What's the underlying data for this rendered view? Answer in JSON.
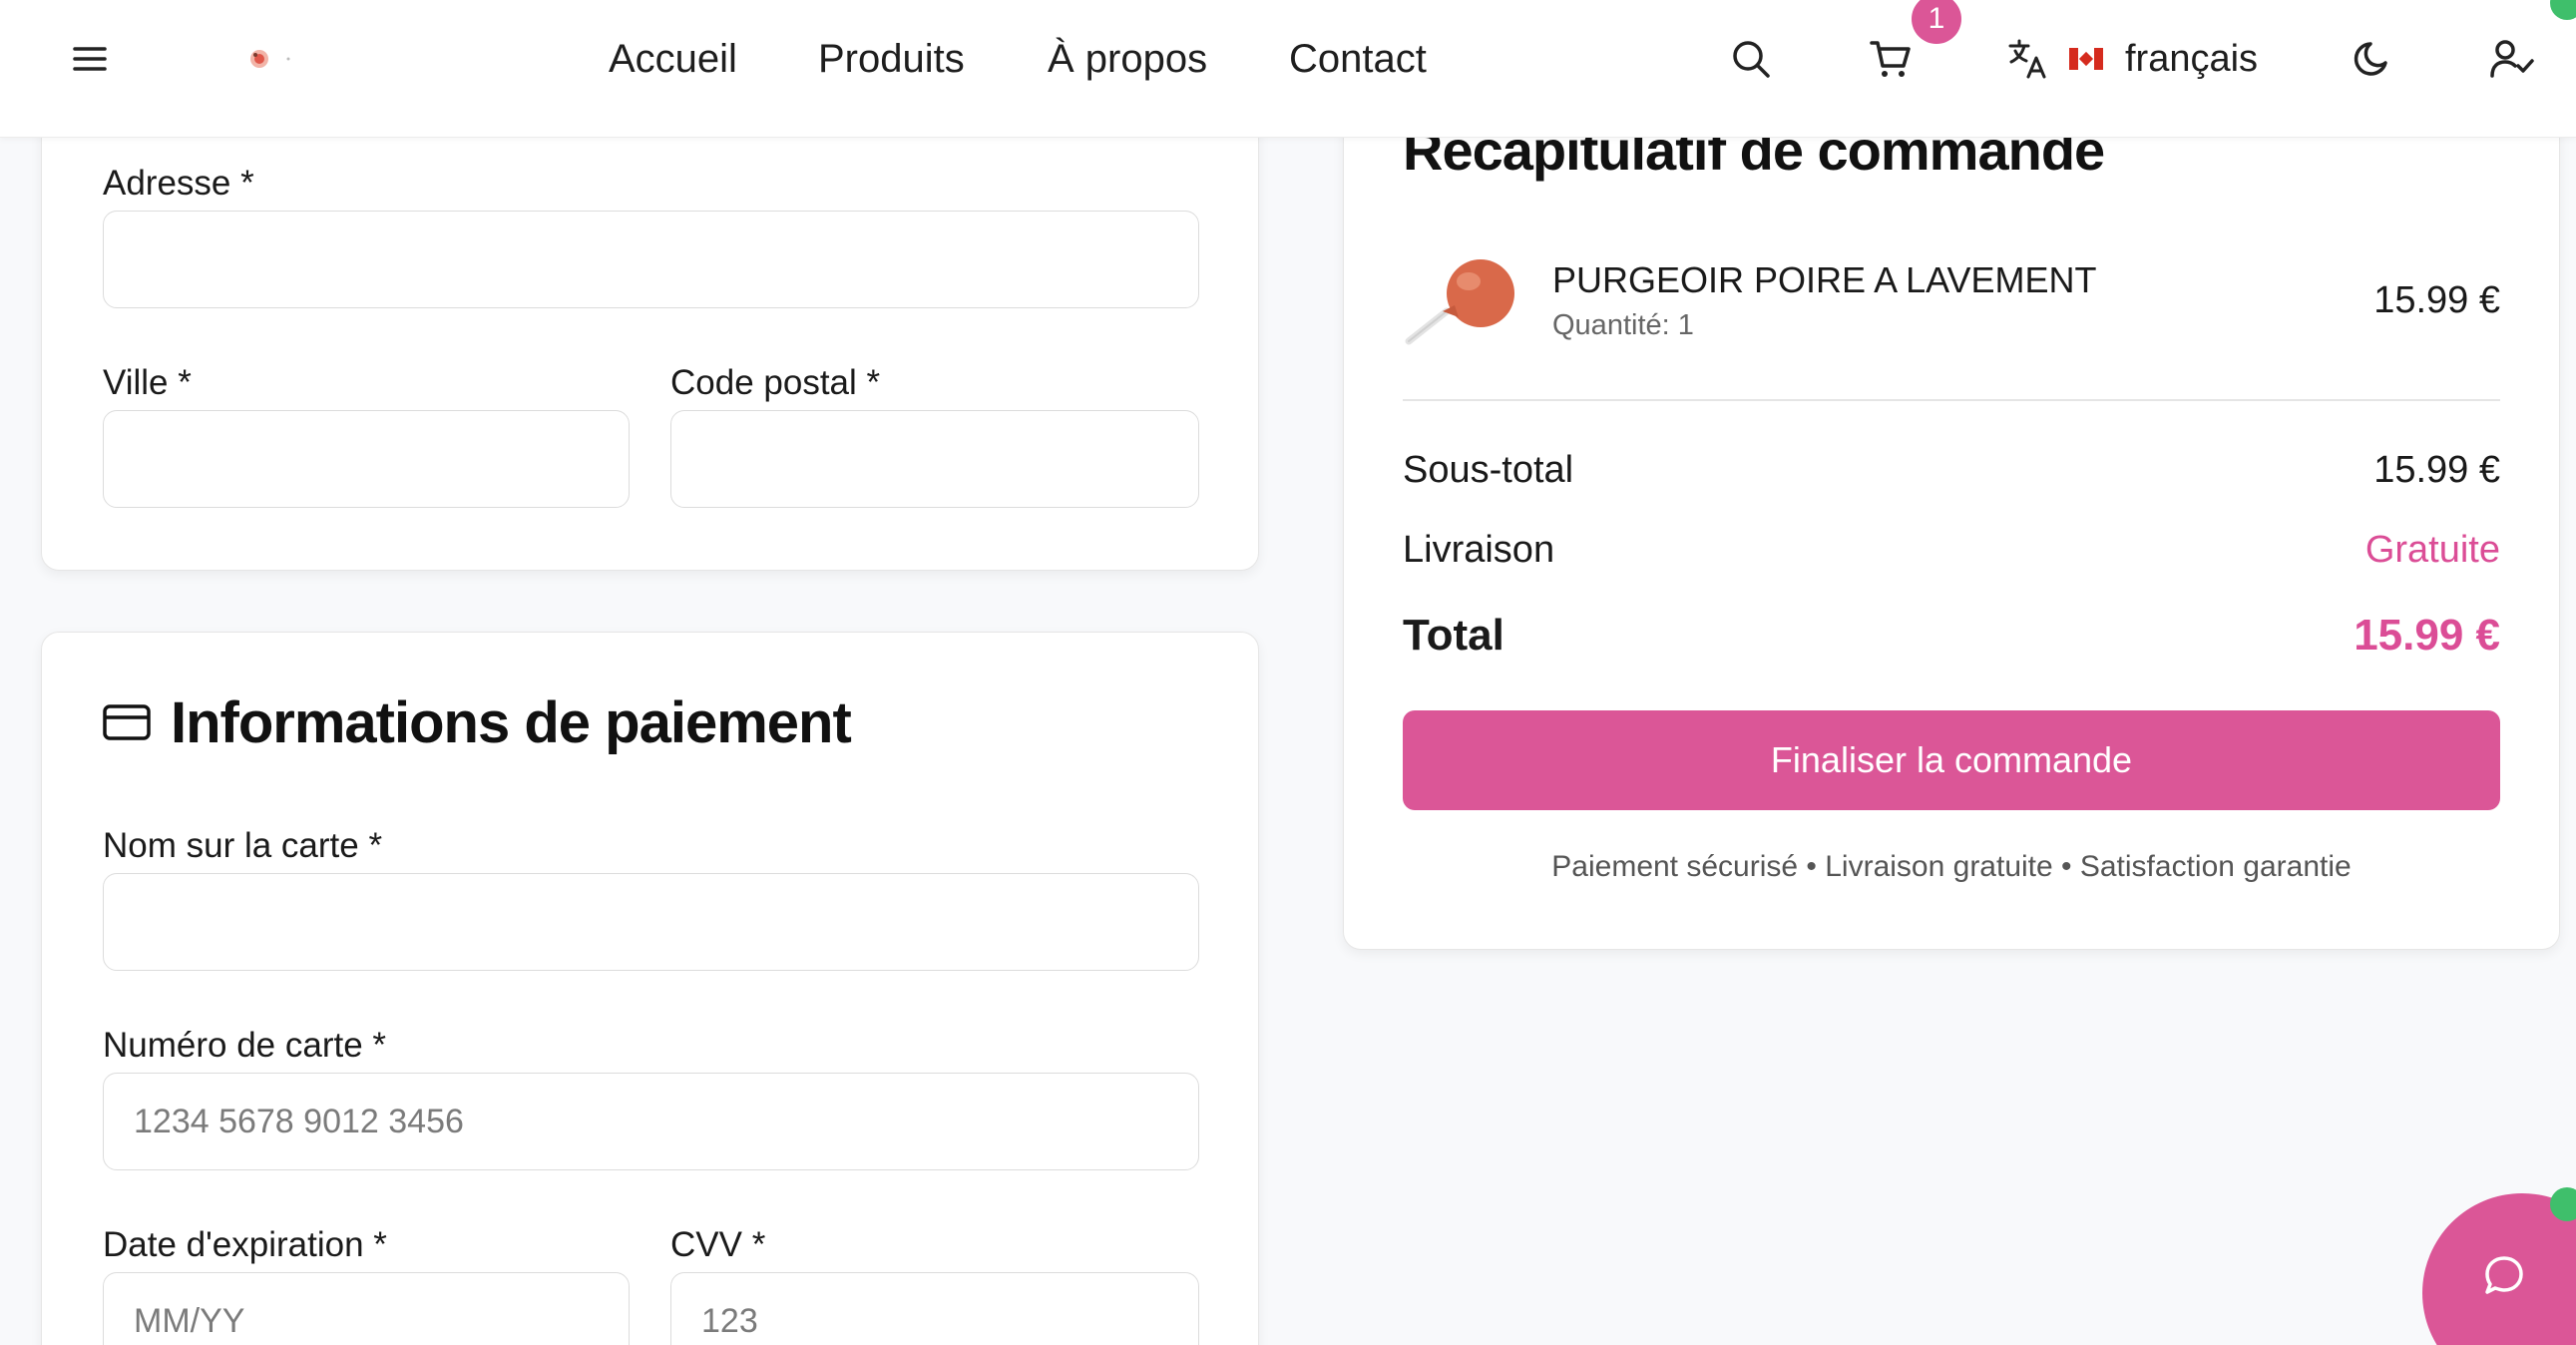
{
  "header": {
    "nav": [
      {
        "label": "Accueil"
      },
      {
        "label": "Produits"
      },
      {
        "label": "À propos"
      },
      {
        "label": "Contact"
      }
    ],
    "cart_count": "1",
    "language": "français",
    "icons": [
      "menu-icon",
      "logo",
      "search-icon",
      "cart-icon",
      "translate-icon",
      "flag-canada",
      "moon-icon",
      "user-check-icon"
    ]
  },
  "shipping_form": {
    "address_label": "Adresse *",
    "address_value": "",
    "city_label": "Ville *",
    "city_value": "",
    "postal_label": "Code postal *",
    "postal_value": ""
  },
  "payment": {
    "title": "Informations de paiement",
    "name_label": "Nom sur la carte *",
    "name_value": "",
    "card_number_label": "Numéro de carte *",
    "card_number_placeholder": "1234 5678 9012 3456",
    "expiry_label": "Date d'expiration *",
    "expiry_placeholder": "MM/YY",
    "cvv_label": "CVV *",
    "cvv_placeholder": "123"
  },
  "summary": {
    "title": "Récapitulatif de commande",
    "item": {
      "name": "PURGEOIR POIRE A LAVEMENT",
      "quantity": "Quantité: 1",
      "price": "15.99 €"
    },
    "subtotal_label": "Sous-total",
    "subtotal_value": "15.99 €",
    "shipping_label": "Livraison",
    "shipping_value": "Gratuite",
    "total_label": "Total",
    "total_value": "15.99 €",
    "checkout_label": "Finaliser la commande",
    "trust_line": "Paiement sécurisé • Livraison gratuite • Satisfaction garantie"
  },
  "colors": {
    "accent": "#db5697",
    "accent_text": "#db4d96",
    "online": "#3fbf6b",
    "flag_red": "#d52b1e"
  }
}
